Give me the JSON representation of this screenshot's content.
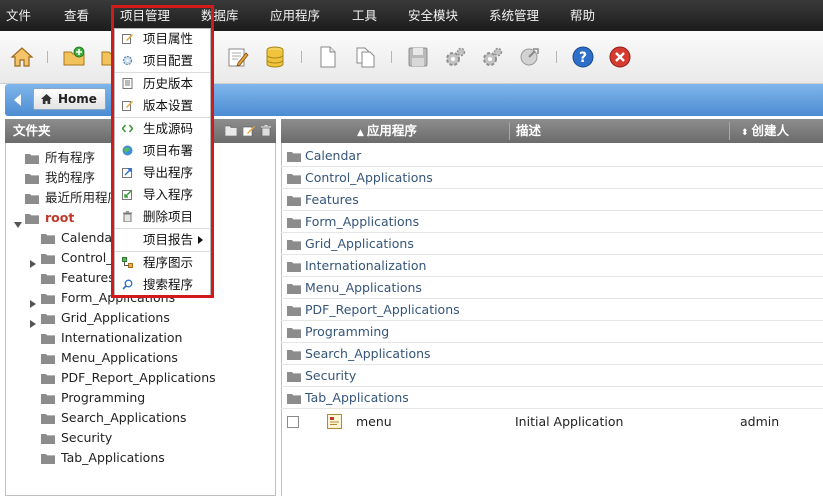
{
  "menubar": {
    "items": [
      "文件",
      "查看",
      "项目管理",
      "数据库",
      "应用程序",
      "工具",
      "安全模块",
      "系统管理",
      "帮助"
    ]
  },
  "toolbar": {
    "icons": [
      "home-icon",
      "add-project-icon",
      "open-project-icon",
      "edit-icon",
      "database-icon",
      "new-document-icon",
      "copy-document-icon",
      "save-icon",
      "settings-icon",
      "generate-icon",
      "deploy-icon",
      "help-icon",
      "close-icon"
    ]
  },
  "breadcrumb": {
    "home_label": "Home"
  },
  "left_panel": {
    "title": "文件夹",
    "items": [
      {
        "label": "所有程序",
        "level": 0
      },
      {
        "label": "我的程序",
        "level": 0
      },
      {
        "label": "最近所用程序",
        "level": 0
      },
      {
        "label": "root",
        "level": 0,
        "expanded": true
      },
      {
        "label": "Calendar",
        "level": 1
      },
      {
        "label": "Control_Applications",
        "level": 1,
        "collapsed": true
      },
      {
        "label": "Features",
        "level": 1
      },
      {
        "label": "Form_Applications",
        "level": 1,
        "collapsed": true
      },
      {
        "label": "Grid_Applications",
        "level": 1,
        "collapsed": true
      },
      {
        "label": "Internationalization",
        "level": 1
      },
      {
        "label": "Menu_Applications",
        "level": 1
      },
      {
        "label": "PDF_Report_Applications",
        "level": 1
      },
      {
        "label": "Programming",
        "level": 1
      },
      {
        "label": "Search_Applications",
        "level": 1
      },
      {
        "label": "Security",
        "level": 1
      },
      {
        "label": "Tab_Applications",
        "level": 1
      }
    ]
  },
  "right_panel": {
    "columns": [
      "应用程序",
      "描述",
      "创建人"
    ],
    "folders": [
      "Calendar",
      "Control_Applications",
      "Features",
      "Form_Applications",
      "Grid_Applications",
      "Internationalization",
      "Menu_Applications",
      "PDF_Report_Applications",
      "Programming",
      "Search_Applications",
      "Security",
      "Tab_Applications"
    ],
    "apps": [
      {
        "name": "menu",
        "description": "Initial Application",
        "creator": "admin"
      }
    ]
  },
  "dropdown": {
    "items": [
      {
        "label": "项目属性",
        "icon": "properties-icon"
      },
      {
        "label": "项目配置",
        "icon": "config-icon"
      },
      {
        "label": "历史版本",
        "icon": "history-icon"
      },
      {
        "label": "版本设置",
        "icon": "version-settings-icon"
      },
      {
        "label": "生成源码",
        "icon": "generate-source-icon"
      },
      {
        "label": "项目布署",
        "icon": "deploy-icon"
      },
      {
        "label": "导出程序",
        "icon": "export-icon"
      },
      {
        "label": "导入程序",
        "icon": "import-icon"
      },
      {
        "label": "删除项目",
        "icon": "trash-icon"
      },
      {
        "label": "项目报告",
        "icon": "",
        "submenu": true
      },
      {
        "label": "程序图示",
        "icon": "diagram-icon"
      },
      {
        "label": "搜索程序",
        "icon": "search-icon"
      }
    ]
  },
  "colors": {
    "accent_blue": "#4c8cd2",
    "highlight_red": "#d21a1a",
    "root_red": "#c0392b",
    "link_blue": "#35557a"
  }
}
